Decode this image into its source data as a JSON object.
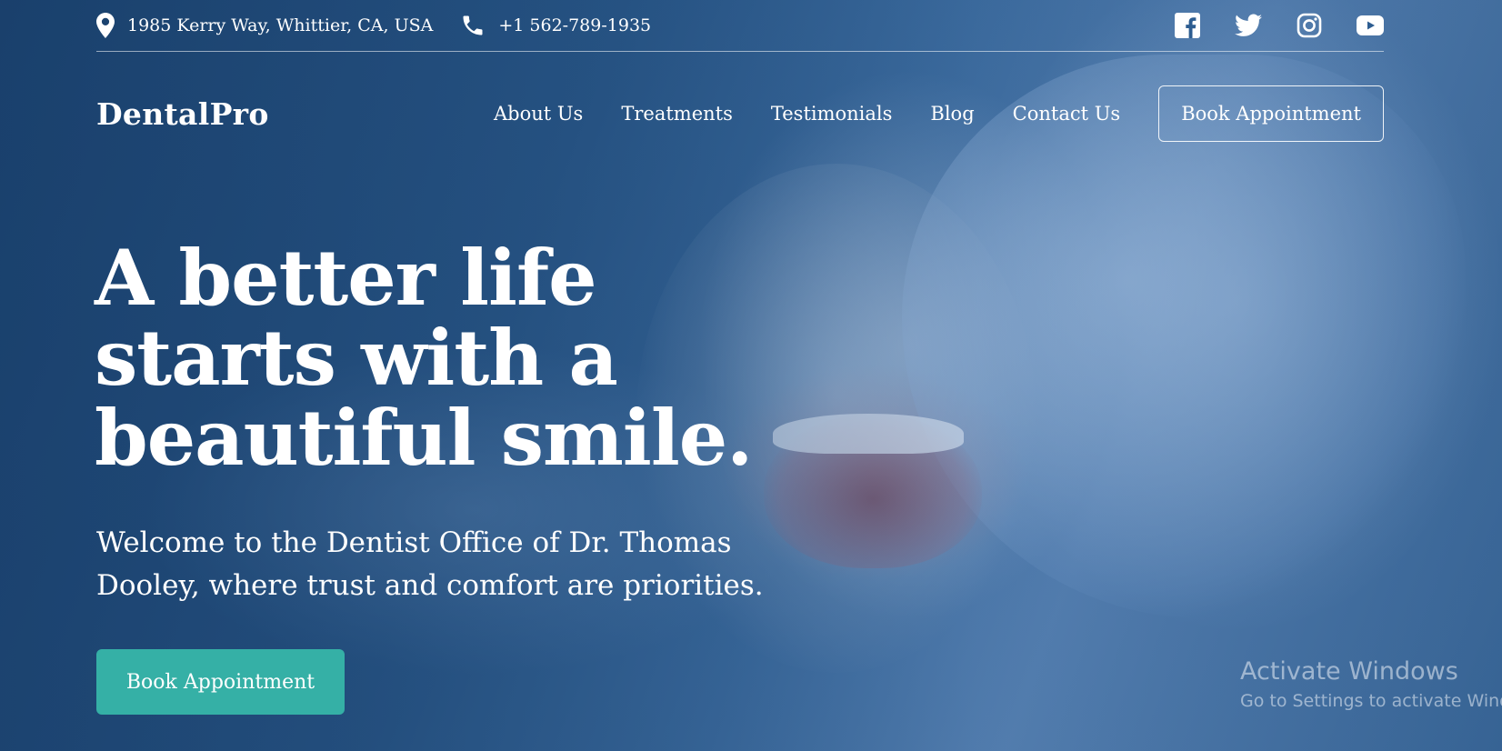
{
  "topbar": {
    "address": "1985 Kerry Way, Whittier, CA, USA",
    "phone": "+1 562-789-1935",
    "address_icon": "map-pin-icon",
    "phone_icon": "phone-icon",
    "socials": [
      {
        "name": "facebook",
        "icon": "facebook-icon"
      },
      {
        "name": "twitter",
        "icon": "twitter-icon"
      },
      {
        "name": "instagram",
        "icon": "instagram-icon"
      },
      {
        "name": "youtube",
        "icon": "youtube-icon"
      }
    ]
  },
  "nav": {
    "logo": "DentalPro",
    "items": [
      "About Us",
      "Treatments",
      "Testimonials",
      "Blog",
      "Contact Us"
    ],
    "cta_label": "Book Appointment"
  },
  "hero": {
    "headline_lines": [
      "A better life",
      "starts with a",
      "beautiful smile."
    ],
    "subtitle_lines": [
      "Welcome to the Dentist Office of Dr. Thomas",
      "Dooley, where trust and comfort are priorities."
    ],
    "cta_label": "Book Appointment"
  },
  "watermark": {
    "title": "Activate Windows",
    "subtitle": "Go to Settings to activate Windows."
  },
  "colors": {
    "accent": "#35b0a6",
    "overlay": "#2b5a8c",
    "text": "#ffffff"
  }
}
